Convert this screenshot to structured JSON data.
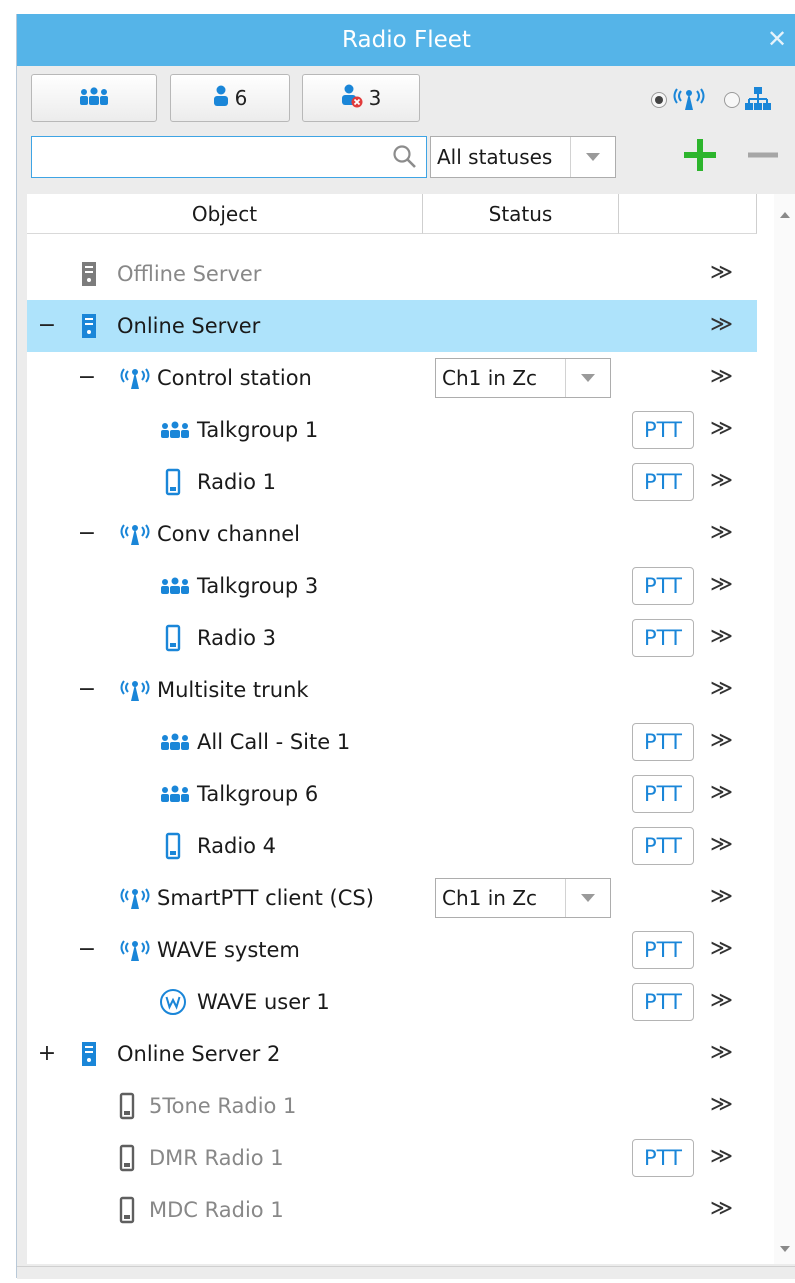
{
  "window": {
    "title": "Radio Fleet",
    "close_glyph": "✕"
  },
  "toolbar": {
    "groups_btn": {
      "icon": "talkgroup-icon"
    },
    "online_users_btn": {
      "icon": "user-icon",
      "count": "6"
    },
    "offline_users_btn": {
      "icon": "user-offline-icon",
      "count": "3"
    },
    "view_mode": {
      "selected": "radio-view",
      "options": [
        "radio-view-icon",
        "hierarchy-view-icon"
      ]
    }
  },
  "filter": {
    "search_value": "",
    "status_selected": "All statuses",
    "add_glyph": "+",
    "remove_glyph": "—"
  },
  "tree": {
    "columns": [
      "Object",
      "Status",
      ""
    ],
    "rows": [
      {
        "label": "Offline Server",
        "expander": "",
        "icon": "server-icon",
        "muted": true,
        "ptt": "",
        "channel": ""
      },
      {
        "label": "Online Server",
        "expander": "−",
        "icon": "server-icon",
        "muted": false,
        "ptt": "",
        "channel": "",
        "selected": true
      },
      {
        "label": "Control station",
        "expander": "−",
        "icon": "antenna-icon",
        "muted": false,
        "ptt": "",
        "channel": "Ch1 in Zc"
      },
      {
        "label": "Talkgroup 1",
        "expander": "",
        "icon": "talkgroup-icon",
        "muted": false,
        "ptt": "PTT",
        "channel": ""
      },
      {
        "label": "Radio 1",
        "expander": "",
        "icon": "radio-icon",
        "muted": false,
        "ptt": "PTT",
        "channel": ""
      },
      {
        "label": "Conv channel",
        "expander": "−",
        "icon": "antenna-icon",
        "muted": false,
        "ptt": "",
        "channel": ""
      },
      {
        "label": "Talkgroup 3",
        "expander": "",
        "icon": "talkgroup-icon",
        "muted": false,
        "ptt": "PTT",
        "channel": ""
      },
      {
        "label": "Radio 3",
        "expander": "",
        "icon": "radio-icon",
        "muted": false,
        "ptt": "PTT",
        "channel": ""
      },
      {
        "label": "Multisite trunk",
        "expander": "−",
        "icon": "antenna-icon",
        "muted": false,
        "ptt": "",
        "channel": ""
      },
      {
        "label": "All Call - Site 1",
        "expander": "",
        "icon": "talkgroup-icon",
        "muted": false,
        "ptt": "PTT",
        "channel": ""
      },
      {
        "label": "Talkgroup 6",
        "expander": "",
        "icon": "talkgroup-icon",
        "muted": false,
        "ptt": "PTT",
        "channel": ""
      },
      {
        "label": "Radio 4",
        "expander": "",
        "icon": "radio-icon",
        "muted": false,
        "ptt": "PTT",
        "channel": ""
      },
      {
        "label": "SmartPTT client (CS)",
        "expander": "",
        "icon": "antenna-icon",
        "muted": false,
        "ptt": "",
        "channel": "Ch1 in Zc"
      },
      {
        "label": "WAVE system",
        "expander": "−",
        "icon": "antenna-icon",
        "muted": false,
        "ptt": "PTT",
        "channel": ""
      },
      {
        "label": "WAVE user 1",
        "expander": "",
        "icon": "wave-user-icon",
        "muted": false,
        "ptt": "PTT",
        "channel": ""
      },
      {
        "label": "Online Server 2",
        "expander": "+",
        "icon": "server-icon",
        "muted": false,
        "ptt": "",
        "channel": ""
      },
      {
        "label": "5Tone Radio 1",
        "expander": "",
        "icon": "radio-icon",
        "muted": true,
        "ptt": "",
        "channel": ""
      },
      {
        "label": "DMR Radio 1",
        "expander": "",
        "icon": "radio-icon",
        "muted": true,
        "ptt": "PTT",
        "channel": ""
      },
      {
        "label": "MDC Radio 1",
        "expander": "",
        "icon": "radio-icon",
        "muted": true,
        "ptt": "",
        "channel": ""
      }
    ],
    "more_glyph": "≫"
  },
  "colors": {
    "accent": "#55b4e8",
    "icon_blue": "#1a86d8",
    "selected_row": "#aee3fb",
    "muted_text": "#888888",
    "add_green": "#2db52d"
  }
}
